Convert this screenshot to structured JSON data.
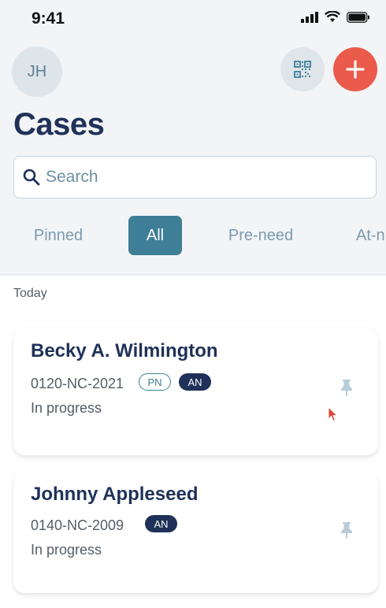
{
  "status_bar": {
    "time": "9:41"
  },
  "header": {
    "avatar_initials": "JH",
    "title": "Cases"
  },
  "search": {
    "placeholder": "Search",
    "value": ""
  },
  "tabs": [
    {
      "label": "Pinned",
      "active": false
    },
    {
      "label": "All",
      "active": true
    },
    {
      "label": "Pre-need",
      "active": false
    },
    {
      "label": "At-n",
      "active": false
    }
  ],
  "section": {
    "label": "Today"
  },
  "cases": [
    {
      "name": "Becky A. Wilmington",
      "case_number": "0120-NC-2021",
      "badges": [
        "PN",
        "AN"
      ],
      "status": "In progress"
    },
    {
      "name": "Johnny Appleseed",
      "case_number": "0140-NC-2009",
      "badges": [
        "AN"
      ],
      "status": "In progress"
    }
  ],
  "colors": {
    "brand_navy": "#1f3158",
    "accent_teal": "#3f7e97",
    "add_button_red": "#ea5b4b",
    "header_bg": "#f2f4f6"
  },
  "icons": [
    "signal-icon",
    "wifi-icon",
    "battery-icon",
    "qr-code-icon",
    "plus-icon",
    "search-icon",
    "pin-icon",
    "cursor-icon"
  ]
}
